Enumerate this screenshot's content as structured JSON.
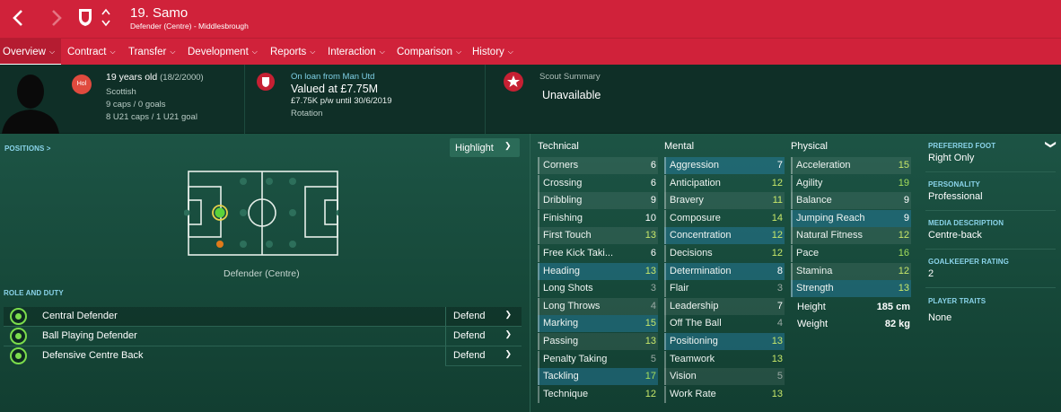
{
  "title_bar": {
    "player_title": "19. Samo",
    "subtitle": "Defender (Centre) - Middlesbrough"
  },
  "nav": [
    {
      "label": "Overview"
    },
    {
      "label": "Contract"
    },
    {
      "label": "Transfer"
    },
    {
      "label": "Development"
    },
    {
      "label": "Reports"
    },
    {
      "label": "Interaction"
    },
    {
      "label": "Comparison"
    },
    {
      "label": "History"
    }
  ],
  "header": {
    "age": "19 years old",
    "dob": "(18/2/2000)",
    "nationality": "Scottish",
    "nation_badge": "Hol",
    "caps": "9 caps / 0 goals",
    "u21_caps": "8 U21 caps / 1 U21 goal",
    "loan": "On loan from Man Utd",
    "value": "Valued at £7.75M",
    "wage": "£7.75K p/w until 30/6/2019",
    "status": "Rotation",
    "scout_title": "Scout Summary",
    "scout_value": "Unavailable"
  },
  "positions": {
    "link": "POSITIONS >",
    "highlight": "Highlight",
    "caption": "Defender (Centre)"
  },
  "role_duty": {
    "title": "ROLE AND DUTY",
    "roles": [
      {
        "name": "Central Defender",
        "duty": "Defend"
      },
      {
        "name": "Ball Playing Defender",
        "duty": "Defend"
      },
      {
        "name": "Defensive Centre Back",
        "duty": "Defend"
      }
    ]
  },
  "attributes": {
    "technical": {
      "title": "Technical",
      "items": [
        {
          "label": "Corners",
          "value": "6"
        },
        {
          "label": "Crossing",
          "value": "6"
        },
        {
          "label": "Dribbling",
          "value": "9"
        },
        {
          "label": "Finishing",
          "value": "10"
        },
        {
          "label": "First Touch",
          "value": "13"
        },
        {
          "label": "Free Kick Taki...",
          "value": "6"
        },
        {
          "label": "Heading",
          "value": "13"
        },
        {
          "label": "Long Shots",
          "value": "3"
        },
        {
          "label": "Long Throws",
          "value": "4"
        },
        {
          "label": "Marking",
          "value": "15"
        },
        {
          "label": "Passing",
          "value": "13"
        },
        {
          "label": "Penalty Taking",
          "value": "5"
        },
        {
          "label": "Tackling",
          "value": "17"
        },
        {
          "label": "Technique",
          "value": "12"
        }
      ]
    },
    "mental": {
      "title": "Mental",
      "items": [
        {
          "label": "Aggression",
          "value": "7"
        },
        {
          "label": "Anticipation",
          "value": "12"
        },
        {
          "label": "Bravery",
          "value": "11"
        },
        {
          "label": "Composure",
          "value": "14"
        },
        {
          "label": "Concentration",
          "value": "12"
        },
        {
          "label": "Decisions",
          "value": "12"
        },
        {
          "label": "Determination",
          "value": "8"
        },
        {
          "label": "Flair",
          "value": "3"
        },
        {
          "label": "Leadership",
          "value": "7"
        },
        {
          "label": "Off The Ball",
          "value": "4"
        },
        {
          "label": "Positioning",
          "value": "13"
        },
        {
          "label": "Teamwork",
          "value": "13"
        },
        {
          "label": "Vision",
          "value": "5"
        },
        {
          "label": "Work Rate",
          "value": "13"
        }
      ]
    },
    "physical": {
      "title": "Physical",
      "items": [
        {
          "label": "Acceleration",
          "value": "15"
        },
        {
          "label": "Agility",
          "value": "19"
        },
        {
          "label": "Balance",
          "value": "9"
        },
        {
          "label": "Jumping Reach",
          "value": "9"
        },
        {
          "label": "Natural Fitness",
          "value": "12"
        },
        {
          "label": "Pace",
          "value": "16"
        },
        {
          "label": "Stamina",
          "value": "12"
        },
        {
          "label": "Strength",
          "value": "13"
        }
      ],
      "height_label": "Height",
      "height": "185 cm",
      "weight_label": "Weight",
      "weight": "82 kg"
    }
  },
  "sidebar": {
    "preferred_foot_label": "PREFERRED FOOT",
    "preferred_foot": "Right Only",
    "personality_label": "PERSONALITY",
    "personality": "Professional",
    "media_label": "MEDIA DESCRIPTION",
    "media": "Centre-back",
    "gk_label": "GOALKEEPER RATING",
    "gk": "2",
    "traits_label": "PLAYER TRAITS",
    "traits": "None"
  },
  "colors": {
    "brand_red": "#d0223a",
    "header_bg": "#0f2f27",
    "pitch_green": "#1c5344",
    "rating_high": "#a6df5c",
    "highlight_row": "#2882aa"
  }
}
